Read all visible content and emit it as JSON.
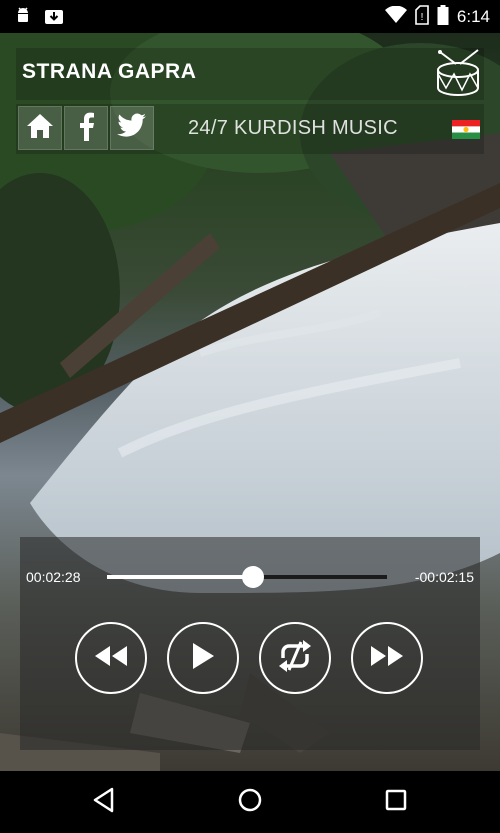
{
  "status_bar": {
    "time": "6:14",
    "icons": [
      "android-debug-icon",
      "download-icon",
      "wifi-icon",
      "no-sim-icon",
      "battery-icon"
    ]
  },
  "header": {
    "title": "STRANA GAPRA",
    "drum_icon": "drum-icon"
  },
  "social": {
    "buttons": [
      {
        "name": "home-icon"
      },
      {
        "name": "facebook-icon"
      },
      {
        "name": "twitter-icon"
      }
    ],
    "tagline": "24/7 KURDISH MUSIC",
    "flag_icon": "kurdistan-flag-icon"
  },
  "player": {
    "elapsed": "00:02:28",
    "remaining": "-00:02:15",
    "progress_fraction": 0.52,
    "controls": [
      "rewind-icon",
      "play-icon",
      "repeat-icon",
      "fast-forward-icon"
    ]
  },
  "nav": {
    "buttons": [
      "back-icon",
      "home-circle-icon",
      "recents-icon"
    ]
  },
  "colors": {
    "flag_red": "#ed2024",
    "flag_green": "#278e43",
    "flag_sun": "#febd11"
  }
}
